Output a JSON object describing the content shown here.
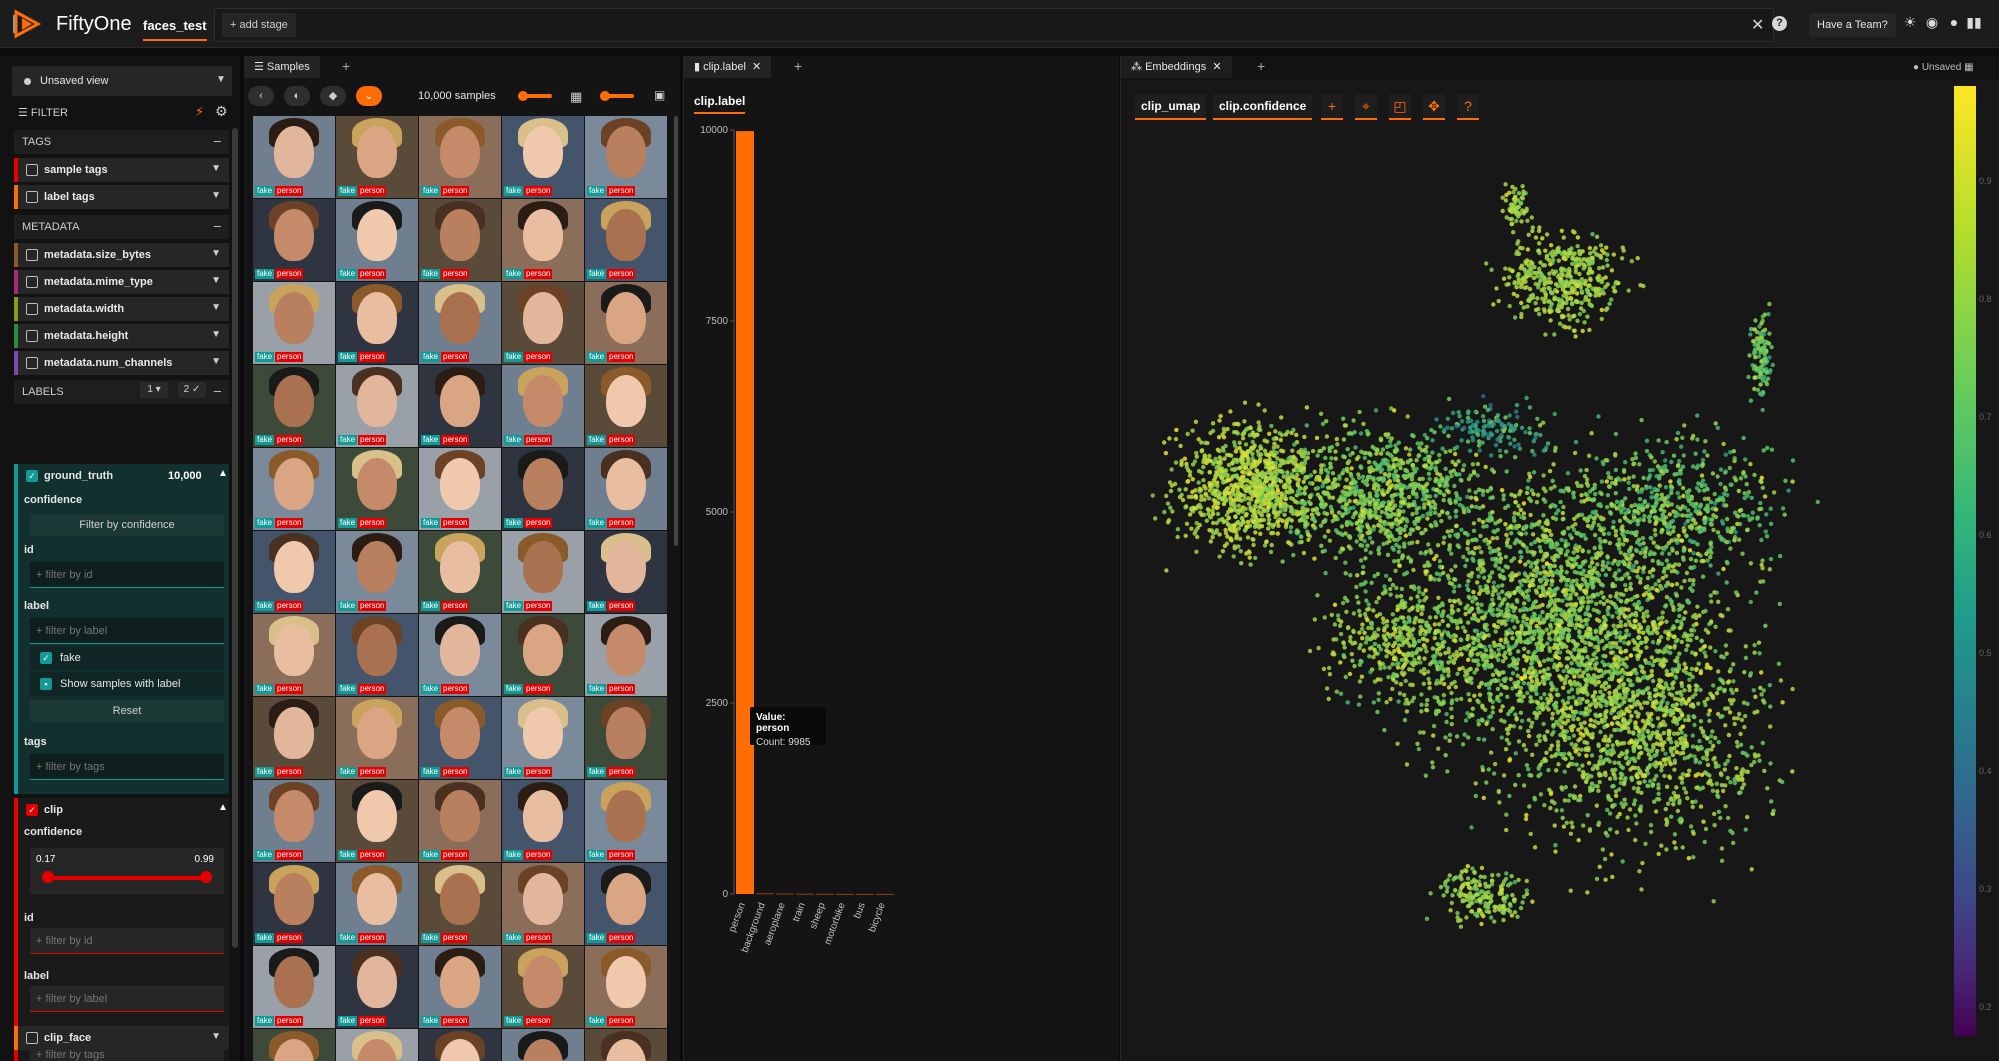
{
  "header": {
    "app_title": "FiftyOne",
    "dataset_name": "faces_test",
    "add_stage_label": "+ add stage",
    "team_button_label": "Have a Team?",
    "icons": [
      "close-icon",
      "help-icon",
      "sun-icon",
      "discord-icon",
      "github-icon",
      "book-icon"
    ]
  },
  "sidebar": {
    "view_select_label": "Unsaved view",
    "filter_heading": "FILTER",
    "tags_heading": "TAGS",
    "tags_fields": [
      "sample tags",
      "label tags"
    ],
    "metadata_heading": "METADATA",
    "metadata_fields": [
      "metadata.size_bytes",
      "metadata.mime_type",
      "metadata.width",
      "metadata.height",
      "metadata.num_channels"
    ],
    "labels_heading": "LABELS",
    "labels_badge_1": "1",
    "labels_badge_2": "2",
    "ground_truth": {
      "name": "ground_truth",
      "count": "10,000",
      "confidence_label": "confidence",
      "filter_confidence_button": "Filter by confidence",
      "id_label": "id",
      "id_placeholder": "+ filter by id",
      "label_label": "label",
      "label_placeholder": "+ filter by label",
      "label_value": "fake",
      "show_samples_label": "Show samples with label",
      "reset_button": "Reset",
      "tags_label": "tags",
      "tags_placeholder": "+ filter by tags"
    },
    "clip": {
      "name": "clip",
      "confidence_label": "confidence",
      "slider_min": "0.17",
      "slider_max": "0.99",
      "id_label": "id",
      "id_placeholder": "+ filter by id",
      "label_label": "label",
      "label_placeholder": "+ filter by label",
      "tags_label": "tags",
      "tags_placeholder": "+ filter by tags"
    },
    "clip_face_field": "clip_face"
  },
  "samples_panel": {
    "tab_label": "Samples",
    "sample_count": "10,000 samples",
    "tag_fake": "fake",
    "tag_person": "person"
  },
  "histogram_panel": {
    "tab_label": "clip.label",
    "field_label": "clip.label",
    "tooltip_value": "Value: person",
    "tooltip_count": "Count: 9985"
  },
  "embeddings_panel": {
    "tab_label": "Embeddings",
    "unsaved_label": "Unsaved",
    "brain_key": "clip_umap",
    "color_by": "clip.confidence",
    "tool_icons": [
      "plus-icon",
      "crosshair-icon",
      "lasso-icon",
      "move-icon",
      "help-icon"
    ]
  },
  "chart_data": [
    {
      "type": "bar",
      "categories": [
        "person",
        "background",
        "aeroplane",
        "train",
        "sheep",
        "motorbike",
        "bus",
        "bicycle"
      ],
      "values": [
        9985,
        5,
        3,
        2,
        2,
        1,
        1,
        1
      ],
      "ylim": [
        0,
        10000
      ],
      "yticks": [
        0,
        2500,
        5000,
        7500,
        10000
      ],
      "color": "#ff6d04",
      "grid": false
    },
    {
      "type": "scatter",
      "title": "",
      "color_map": "viridis",
      "color_range": [
        0.17,
        0.99
      ],
      "colorbar_ticks": [
        "0.9",
        "0.8",
        "0.7",
        "0.6",
        "0.5",
        "0.4",
        "0.3",
        "0.2"
      ],
      "point_count": 10000
    }
  ],
  "colors": {
    "accent": "#ff6d04",
    "ground_truth": "#129a96",
    "clip": "#e40000",
    "background": "#141414"
  }
}
